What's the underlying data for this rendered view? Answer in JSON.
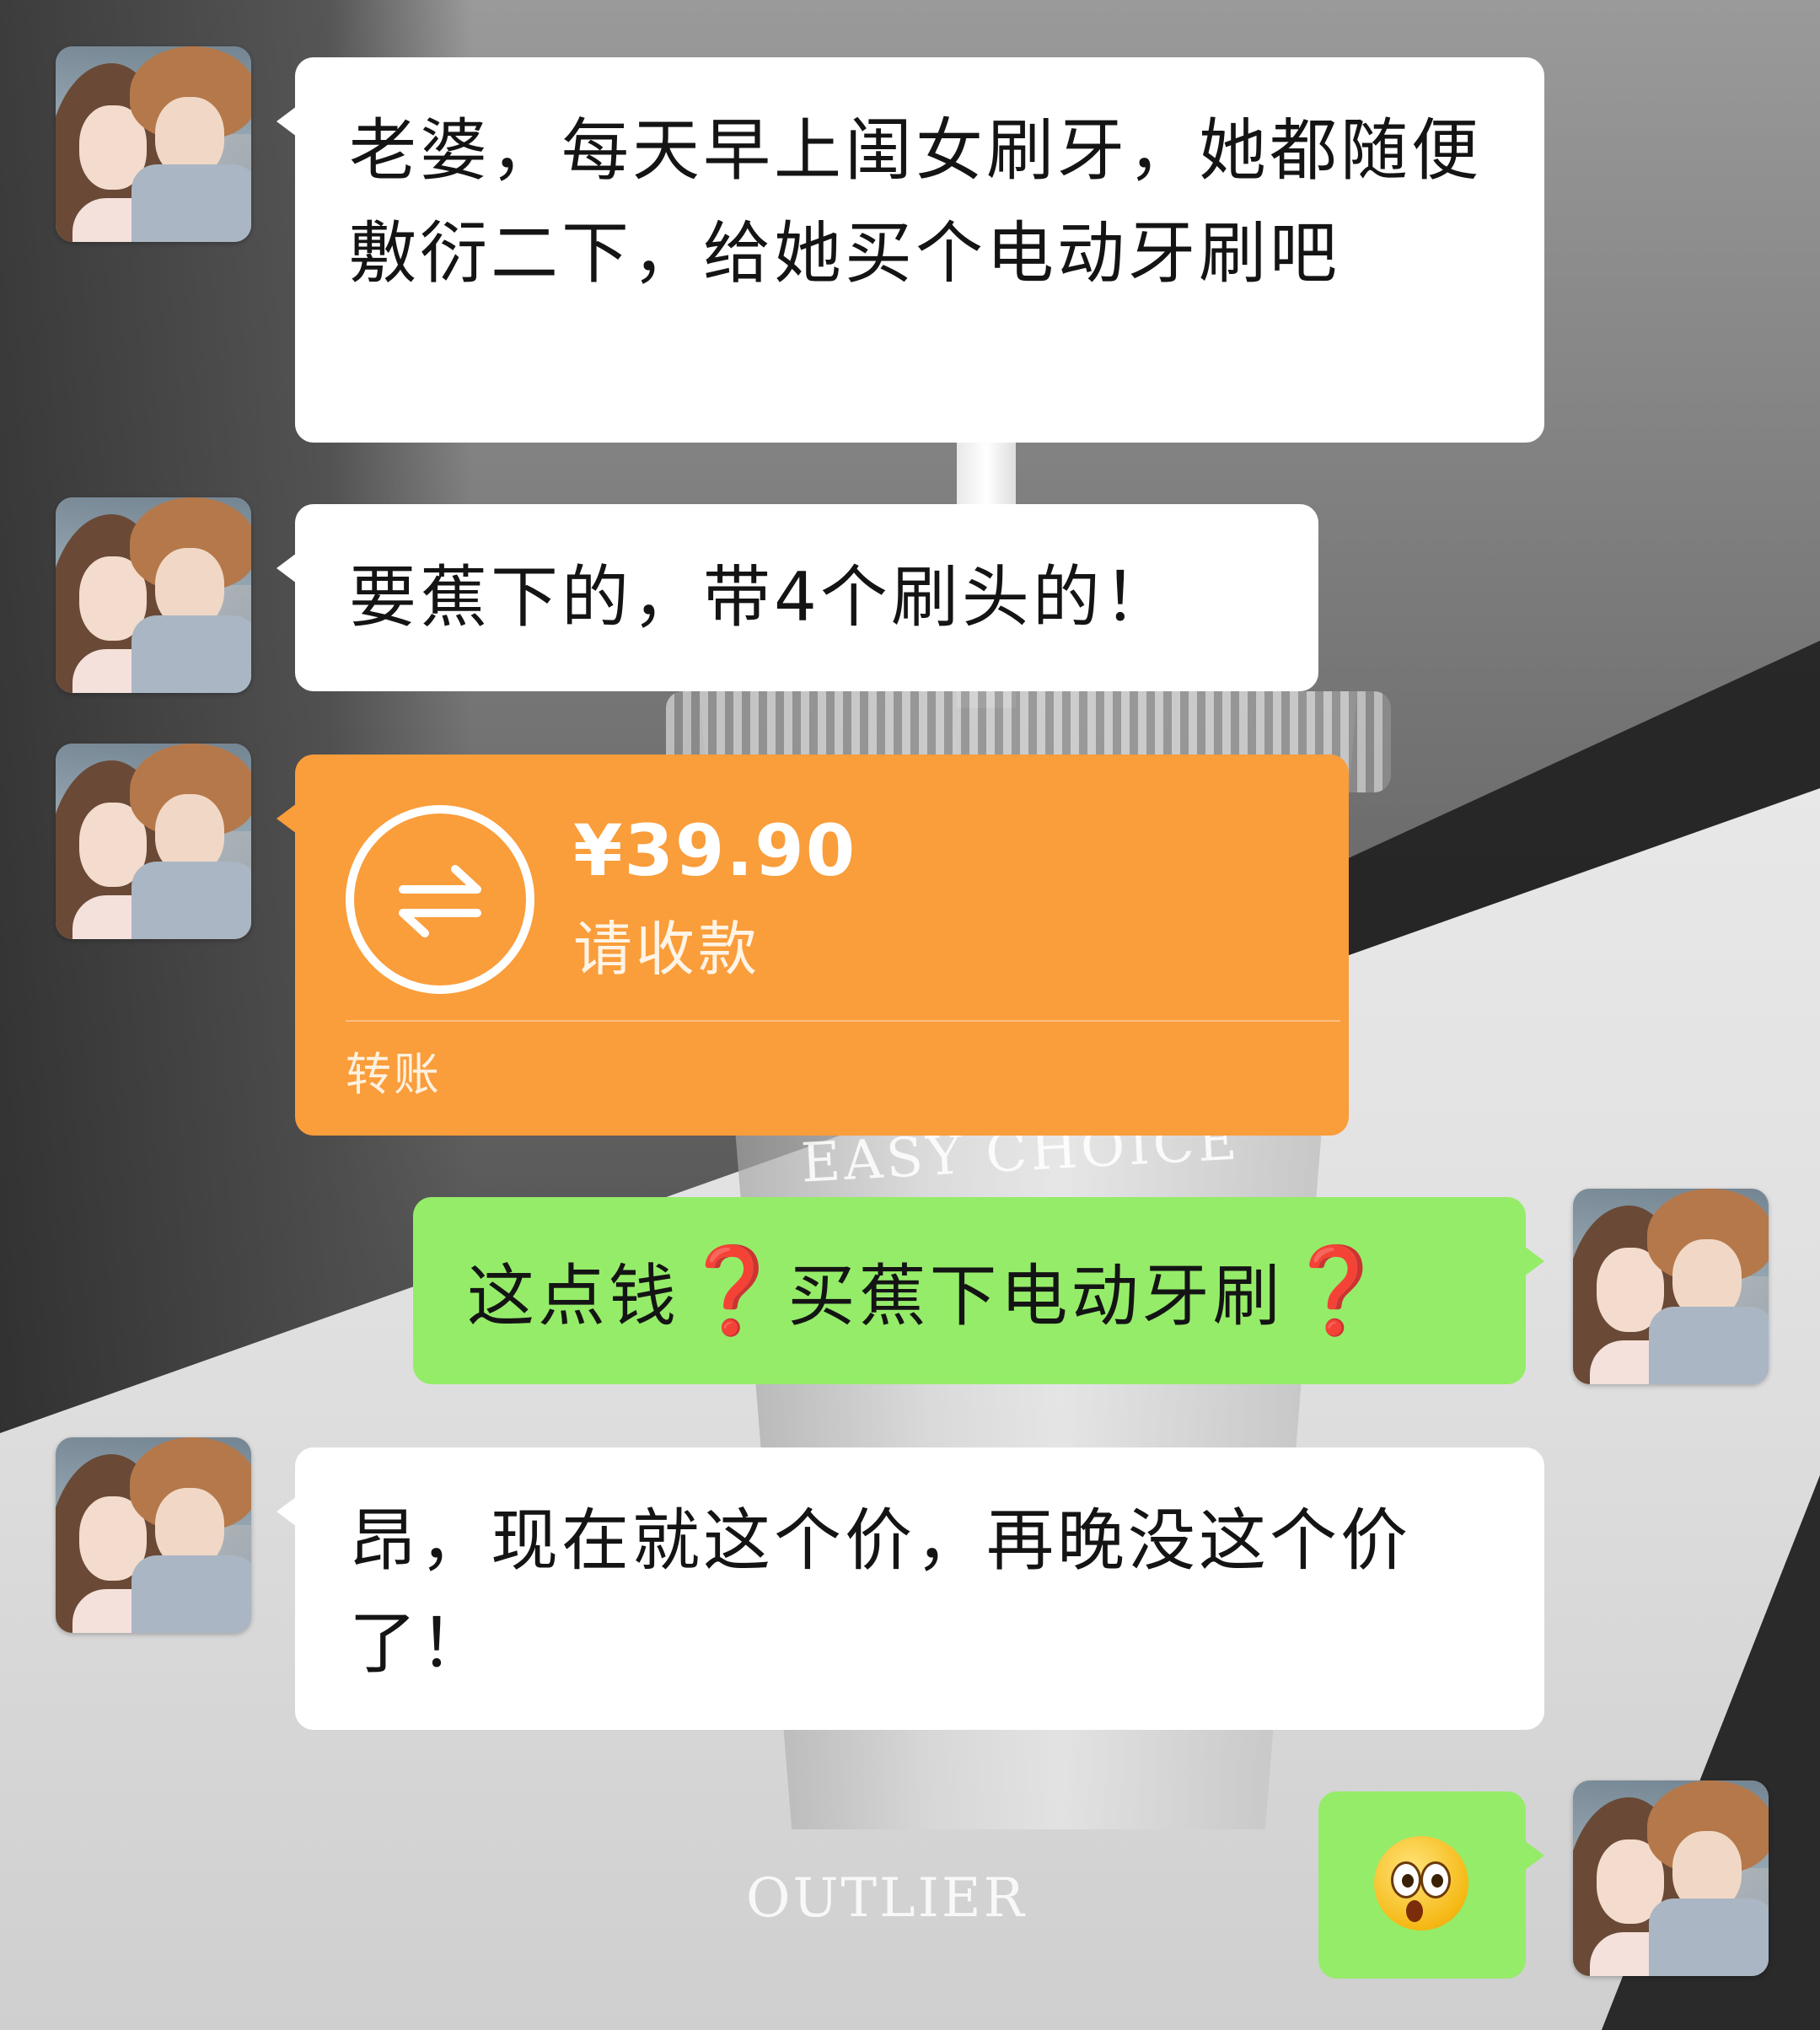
{
  "messages": [
    {
      "side": "left",
      "type": "text",
      "text": "老婆，每天早上闺女刷牙，她都随便敷衍二下，给她买个电动牙刷吧"
    },
    {
      "side": "left",
      "type": "text",
      "text": "要蕉下的，带4个刷头的！"
    },
    {
      "side": "left",
      "type": "transfer",
      "amount": "¥39.90",
      "status": "请收款",
      "label": "转账"
    },
    {
      "side": "right",
      "type": "text",
      "parts": [
        "这点钱",
        "❓",
        "买蕉下电动牙刷",
        "❓"
      ]
    },
    {
      "side": "left",
      "type": "text",
      "text": "昂，现在就这个价，再晚没这个价了！"
    },
    {
      "side": "right",
      "type": "sticker",
      "emoji_name": "surprised-face-emoji"
    }
  ],
  "background": {
    "cup_print": "EASY CHOICE",
    "watermark": "OUTLIER"
  },
  "colors": {
    "incoming_bubble": "#ffffff",
    "outgoing_bubble": "#95ec69",
    "transfer_card": "#fa9d3b",
    "question_mark": "#e0262a"
  }
}
